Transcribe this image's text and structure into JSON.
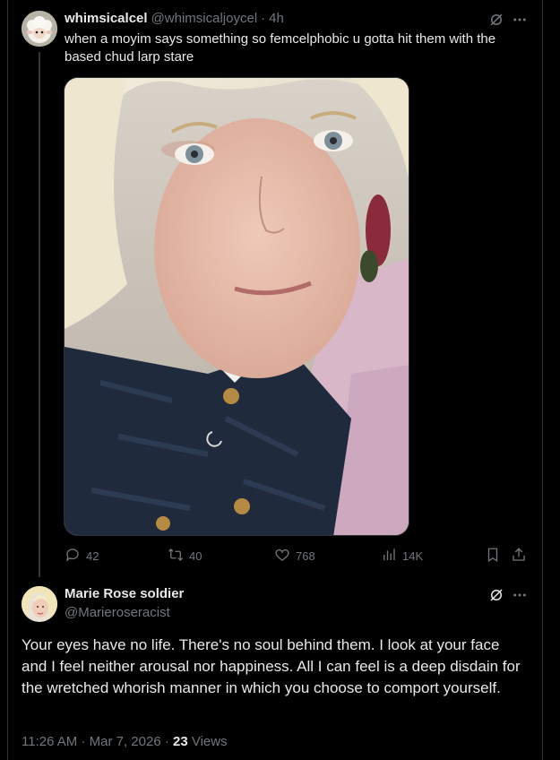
{
  "tweet": {
    "display_name": "whimsicalcel",
    "handle": "@whimsicaljoycel",
    "separator": "·",
    "time": "4h",
    "text": "when a moyim says something so femcelphobic u gotta hit them with the based chud larp stare",
    "stats": {
      "replies": "42",
      "reposts": "40",
      "likes": "768",
      "views": "14K"
    }
  },
  "reply": {
    "display_name": "Marie Rose soldier",
    "handle": "@Marieroseracist",
    "text": "Your eyes have no life. There's no soul behind them. I look at your face and I feel neither arousal nor happiness. All I can feel is a deep disdain for the wretched whorish manner in which you choose to comport yourself.",
    "time": "11:26 AM",
    "date": "Mar 7, 2026",
    "dot": "·",
    "views_count": "23",
    "views_label": "Views"
  },
  "icons": {
    "grok": "grok-icon",
    "more": "more-icon",
    "reply": "reply-icon",
    "repost": "repost-icon",
    "like": "like-icon",
    "views": "views-icon",
    "bookmark": "bookmark-icon",
    "share": "share-icon"
  },
  "colors": {
    "background": "#000000",
    "text": "#e7e9ea",
    "secondary": "#71767b",
    "border": "#2f3336"
  }
}
